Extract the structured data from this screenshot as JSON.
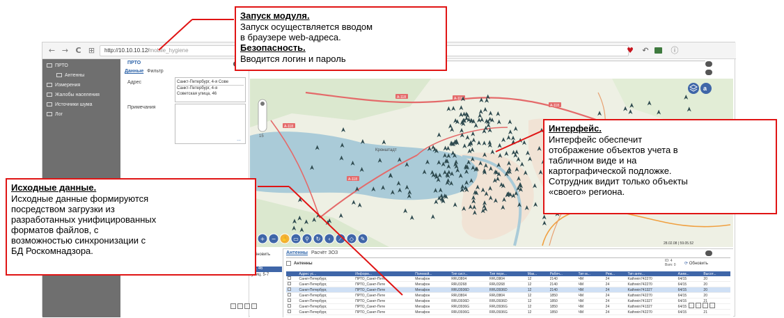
{
  "browser": {
    "url_host": "http://10.10.10.12/",
    "url_path": "mobile_hygiene",
    "nav_back": "←",
    "nav_forward": "→",
    "nav_reload": "C",
    "nav_apps": "⊞",
    "nav_info": "ⓘ"
  },
  "sidebar": {
    "items": [
      {
        "label": "ПРТО",
        "sub": false
      },
      {
        "label": "Антенны",
        "sub": true
      },
      {
        "label": "Измерения",
        "sub": false
      },
      {
        "label": "Жалобы населения",
        "sub": false
      },
      {
        "label": "Источники шума",
        "sub": false
      },
      {
        "label": "Лог",
        "sub": false
      }
    ]
  },
  "form": {
    "section_title": "ПРТО",
    "tab_data": "Данные",
    "tab_filter": "Фильтр",
    "address_label": "Адрес",
    "address_value_1": "Санкт-Петербург, 4-я Сове",
    "address_value_2": "Санкт-Петербург, 4-я",
    "address_value_3": "Советская улица, 46",
    "notes_label": "Примечания",
    "more": "..."
  },
  "map": {
    "road_labels": [
      "A-118",
      "A-118",
      "A-118",
      "A-118",
      "A-118"
    ],
    "place_label": "Кронштадт",
    "zoom_level": "15",
    "scale_text": "28.02.08 | 59.05.52"
  },
  "bottom": {
    "tab_antennas": "Антенны",
    "tab_calc": "Расчёт ЗОЗ",
    "refresh_left": "Обновить",
    "refresh_right": "Обновить",
    "grid_title": "Антенны",
    "page_info_1": "ID: 4",
    "page_info_2": "Bsm: 0",
    "left_item_1": "ул. 46",
    "left_item_2": "улиц. 5-7",
    "columns": [
      "Адрес ус...",
      "Информ...",
      "Полевой...",
      "Тип сист...",
      "Тип пере...",
      "Мак...",
      "Рабоч...",
      "Тип м...",
      "Реж...",
      "Тип анте...",
      "Азим...",
      "Высот..."
    ],
    "rows": [
      [
        "Санкт-Петербург,",
        "ПРТО_Санкт-Пете",
        "Мегафон",
        "RRU3804",
        "RRU3804",
        "12",
        "2140",
        "ЧМ",
        "24",
        "Kathrein742270",
        "64/15",
        "20"
      ],
      [
        "Санкт-Петербург,",
        "ПРТО_Санкт-Пете",
        "Мегафон",
        "RRU3268",
        "RRU3268",
        "12",
        "2140",
        "ЧМ",
        "24",
        "Kathrein742270",
        "64/15",
        "20"
      ],
      [
        "Санкт-Петербург,",
        "ПРТО_Санкт-Пете",
        "Мегафон",
        "RRU3936D",
        "RRU3936D",
        "12",
        "2140",
        "ЧМ",
        "24",
        "Kathrein741327",
        "64/15",
        "20"
      ],
      [
        "Санкт-Петербург,",
        "ПРТО_Санкт-Пете",
        "Мегафон",
        "RRU3804",
        "RRU3804",
        "12",
        "1850",
        "ЧМ",
        "24",
        "Kathrein742270",
        "64/15",
        "20"
      ],
      [
        "Санкт-Петербург,",
        "ПРТО_Санкт-Пете",
        "Мегафон",
        "RRU3936D",
        "RRU3936D",
        "12",
        "1850",
        "ЧМ",
        "24",
        "Kathrein741327",
        "64/15",
        "21"
      ],
      [
        "Санкт-Петербург,",
        "ПРТО_Санкт-Пете",
        "Мегафон",
        "RRU3936G",
        "RRU3936G",
        "12",
        "1850",
        "ЧМ",
        "24",
        "Kathrein741327",
        "64/15",
        "21"
      ],
      [
        "Санкт-Петербург,",
        "ПРТО_Санкт-Пете",
        "Мегафон",
        "RRU3936G",
        "RRU3936G",
        "12",
        "1850",
        "ЧМ",
        "24",
        "Kathrein742270",
        "64/15",
        "21"
      ]
    ],
    "selected_row": 2
  },
  "annotations": {
    "launch_heading": "Запуск модуля.",
    "launch_text_1": "Запуск осуществляется вводом",
    "launch_text_2": "в браузере web-адреса.",
    "security_heading": "Безопасность.",
    "security_text": "Вводится логин и пароль",
    "interface_heading": "Интерфейс.",
    "interface_text_1": "Интерфейс обеспечит",
    "interface_text_2": "отображение объектов учета в",
    "interface_text_3": "табличном виде и на",
    "interface_text_4": "картографической подложке.",
    "interface_text_5": "Сотрудник видит только объекты",
    "interface_text_6": "«своего» региона.",
    "source_heading": "Исходные данные.",
    "source_text_1": "Исходные данные формируются",
    "source_text_2": "посредством загрузки из",
    "source_text_3": "разработанных унифицированных",
    "source_text_4": "форматов файлов, с",
    "source_text_5": "возможностью синхронизации с",
    "source_text_6": "БД Роскомнадзора."
  },
  "colors": {
    "annotation_border": "#e01414",
    "sidebar_bg": "#6f6f6f",
    "sea": "#aacbd8",
    "land": "#eef0e4",
    "marker": "#2e4a4f",
    "grid_header": "#3f66a8"
  }
}
